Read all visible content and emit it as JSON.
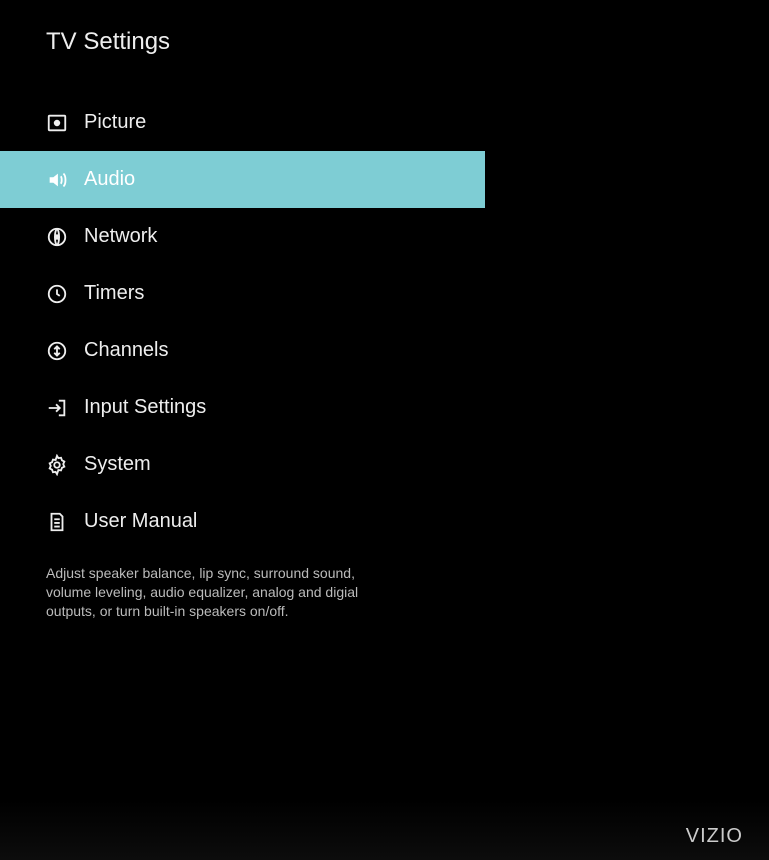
{
  "title": "TV Settings",
  "menu": {
    "items": [
      {
        "label": "Picture",
        "icon": "picture-icon"
      },
      {
        "label": "Audio",
        "icon": "audio-icon"
      },
      {
        "label": "Network",
        "icon": "network-icon"
      },
      {
        "label": "Timers",
        "icon": "clock-icon"
      },
      {
        "label": "Channels",
        "icon": "channels-icon"
      },
      {
        "label": "Input Settings",
        "icon": "input-icon"
      },
      {
        "label": "System",
        "icon": "gear-icon"
      },
      {
        "label": "User Manual",
        "icon": "document-icon"
      }
    ],
    "selectedIndex": 1
  },
  "description": "Adjust speaker balance, lip sync, surround sound, volume leveling, audio equalizer, analog and digial outputs, or turn built-in speakers on/off.",
  "brand": "VIZIO"
}
